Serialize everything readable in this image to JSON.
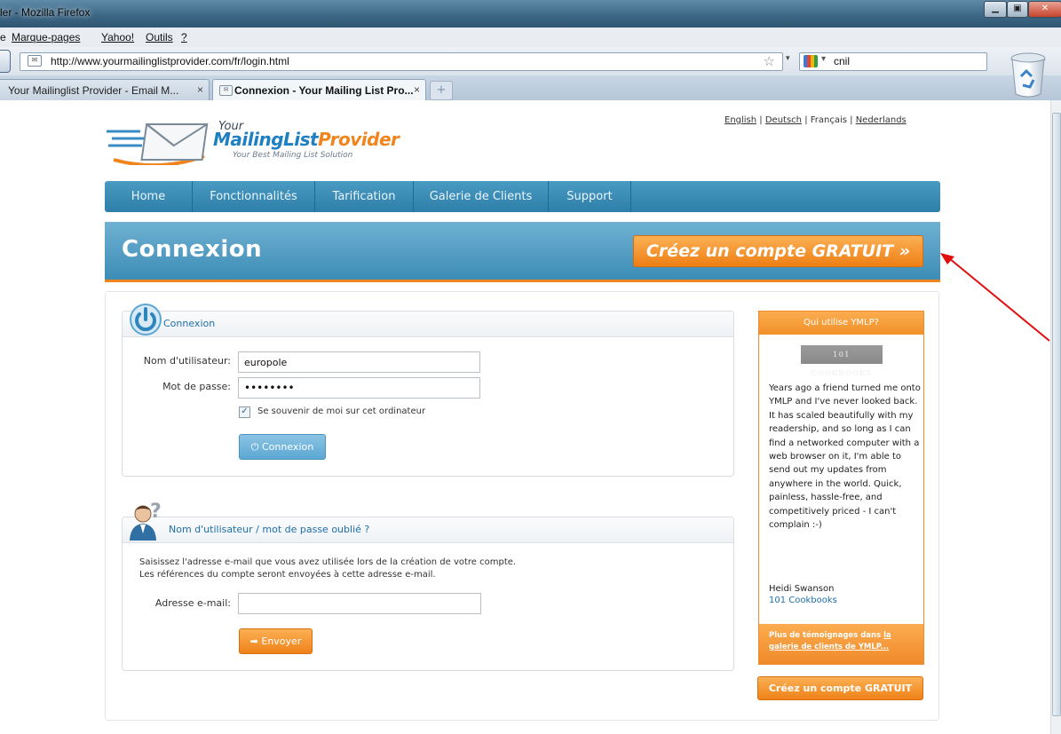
{
  "browser": {
    "window_title": "ler - Mozilla Firefox",
    "menu": [
      "e",
      "Marque-pages",
      "Yahoo!",
      "Outils",
      "?"
    ],
    "url": "http://www.yourmailinglistprovider.com/fr/login.html",
    "search_query": "cnil",
    "tabs": [
      {
        "label": "Your Mailinglist Provider - Email M...",
        "active": false
      },
      {
        "label": "Connexion - Your Mailing List Pro...",
        "active": true
      }
    ],
    "close_glyph": "×",
    "newtab_glyph": "+"
  },
  "logo": {
    "line1": "Your",
    "line2a": "MailingList",
    "line2b": "Provider",
    "tagline": "Your Best Mailing List Solution"
  },
  "languages": [
    "English",
    "Deutsch",
    "Français",
    "Nederlands"
  ],
  "nav": [
    "Home",
    "Fonctionnalités",
    "Tarification",
    "Galerie de Clients",
    "Support"
  ],
  "hero": {
    "title": "Connexion",
    "cta": "Créez un compte GRATUIT",
    "cta_suffix": "»"
  },
  "login": {
    "heading": "Connexion",
    "username_label": "Nom d'utilisateur:",
    "username_value": "europole",
    "password_label": "Mot de passe:",
    "password_value": "••••••••",
    "remember_label": "Se souvenir de moi sur cet ordinateur",
    "remember_checked": true,
    "submit": "Connexion",
    "submit_icon": "power-icon"
  },
  "forgot": {
    "heading": "Nom d'utilisateur / mot de passe oublié ?",
    "line1": "Saisissez l'adresse e-mail que vous avez utilisée lors de la création de votre compte.",
    "line2": "Les références du compte seront envoyées à cette adresse e-mail.",
    "email_label": "Adresse e-mail:",
    "email_value": "",
    "submit": "Envoyer",
    "submit_icon": "arrow-right-icon"
  },
  "sidebar": {
    "heading": "Qui utilise YMLP?",
    "badge": "101 Cookbooks",
    "quote": "Years ago a friend turned me onto YMLP and I've never looked back. It has scaled beautifully with my readership, and so long as I can find a networked computer with a web browser on it, I'm able to send out my updates from anywhere in the world. Quick, painless, hassle-free, and competitively priced - I can't complain :-)",
    "author": "Heidi Swanson",
    "author_link": "101 Cookbooks",
    "more_prefix": "Plus de témoignages dans ",
    "more_link": "la galerie de clients de YMLP...",
    "cta": "Créez un compte GRATUIT"
  },
  "colors": {
    "accent_blue": "#2d7ea8",
    "accent_orange": "#f0841d",
    "annotation_arrow": "#e01010"
  }
}
